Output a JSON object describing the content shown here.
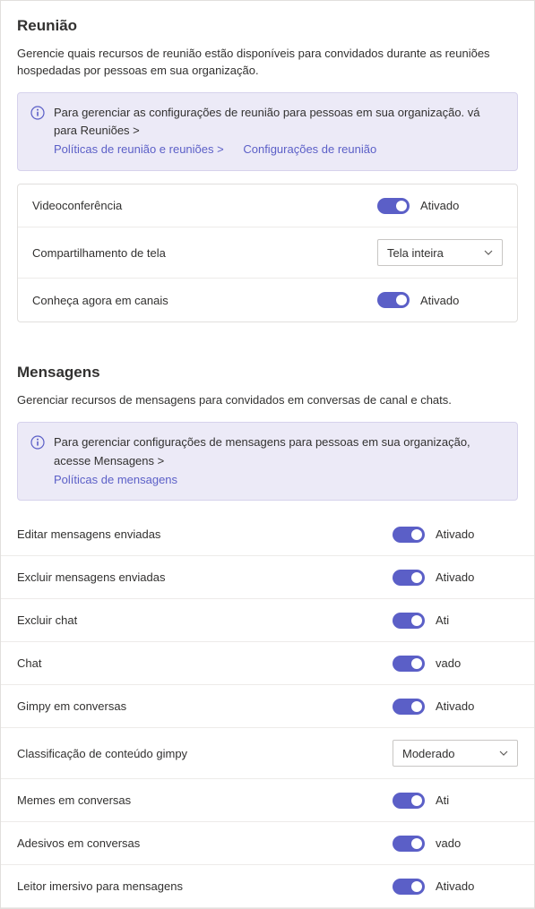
{
  "meeting": {
    "title": "Reunião",
    "description": "Gerencie quais recursos de reunião estão disponíveis para convidados durante as reuniões hospedadas por pessoas em sua organização.",
    "info": {
      "lead": "Para gerenciar as configurações de reunião para pessoas em sua organização. vá para Reuniões >",
      "link1": "Políticas de reunião e reuniões >",
      "link2": "Configurações de reunião"
    },
    "rows": [
      {
        "label": "Videoconferência",
        "type": "toggle",
        "value": "Ativado"
      },
      {
        "label": "Compartilhamento de tela",
        "type": "select",
        "value": "Tela inteira"
      },
      {
        "label": "Conheça agora em canais",
        "type": "toggle",
        "value": "Ativado"
      }
    ]
  },
  "messages": {
    "title": "Mensagens",
    "description": "Gerenciar recursos de mensagens para convidados em conversas de canal e chats.",
    "info": {
      "lead": "Para gerenciar configurações de mensagens para pessoas em sua organização, acesse Mensagens >",
      "link1": "Políticas de mensagens"
    },
    "rows": [
      {
        "label": "Editar mensagens enviadas",
        "type": "toggle",
        "value": "Ativado"
      },
      {
        "label": "Excluir mensagens enviadas",
        "type": "toggle",
        "value": "Ativado"
      },
      {
        "label": "Excluir chat",
        "type": "toggle",
        "value": "Ati"
      },
      {
        "label": "Chat",
        "type": "toggle",
        "value": "vado"
      },
      {
        "label": "Gimpy em conversas",
        "type": "toggle",
        "value": "Ativado"
      },
      {
        "label": "Classificação de conteúdo gimpy",
        "type": "select",
        "value": "Moderado"
      },
      {
        "label": "Memes em conversas",
        "type": "toggle",
        "value": "Ati"
      },
      {
        "label": "Adesivos em conversas",
        "type": "toggle",
        "value": "vado"
      },
      {
        "label": "Leitor imersivo para mensagens",
        "type": "toggle",
        "value": "Ativado"
      }
    ]
  }
}
